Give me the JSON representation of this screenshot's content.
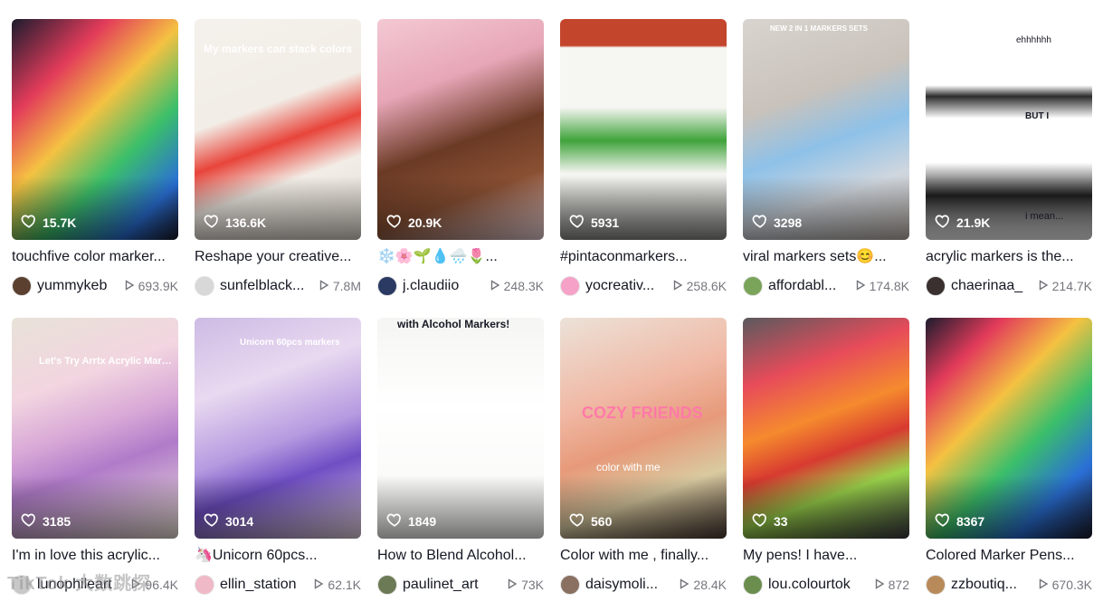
{
  "videos": [
    {
      "likes": "15.7K",
      "title": "touchfive color marker...",
      "user": "yummykeb",
      "views": "693.9K",
      "thumb": "linear-gradient(135deg,#1c1c2e 0%,#e23b5a 25%,#f5c142 45%,#3bbf6a 65%,#2a6fd6 85%,#1a1a2a 100%)",
      "avatar": "#5b4030"
    },
    {
      "likes": "136.6K",
      "title": "Reshape your creative...",
      "user": "sunfelblack...",
      "views": "7.8M",
      "thumb": "linear-gradient(160deg,#f4f1ec 0%,#f2ede6 40%,#e8443a 55%,#f2ede6 70%,#dfd8cf 100%)",
      "avatar": "#d8d8d8"
    },
    {
      "likes": "20.9K",
      "title": "❄️🌸🌱💧🌧️🌷...",
      "user": "j.claudiio",
      "views": "248.3K",
      "thumb": "linear-gradient(160deg,#f3c9d3 0%,#e7a6b7 30%,#6b3a25 55%,#8a5033 75%,#f0d7dd 100%)",
      "avatar": "#2b3a63"
    },
    {
      "likes": "5931",
      "title": "#pintaconmarkers...",
      "user": "yocreativ...",
      "views": "258.6K",
      "thumb": "linear-gradient(180deg,#c3452c 0%,#c3452c 12%,#f6f6f2 13%,#f6f6f2 40%,#3fa33a 55%,#f6f6f2 70%,#8e8e8a 100%)",
      "avatar": "#f6a1c8"
    },
    {
      "likes": "3298",
      "title": "viral markers sets😊...",
      "user": "affordabl...",
      "views": "174.8K",
      "thumb": "linear-gradient(160deg,#d9d4cf 0%,#c9c2bb 35%,#8ec1e8 55%,#cfd6de 75%,#bfb6ae 100%)",
      "avatar": "#7aa45a"
    },
    {
      "likes": "21.9K",
      "title": "acrylic markers is the...",
      "user": "chaerinaa_",
      "views": "214.7K",
      "thumb": "linear-gradient(180deg,#ffffff 0%,#ffffff 30%,#2c2c2c 35%,#ffffff 45%,#ffffff 65%,#1e1e1e 80%,#ffffff 100%)",
      "avatar": "#3a3030"
    },
    {
      "likes": "3185",
      "title": "I'm in love this acrylic...",
      "user": "lunophileart",
      "views": "96.4K",
      "thumb": "linear-gradient(160deg,#e8e2d8 0%,#f2d5e0 30%,#d7a6d6 50%,#b07bc9 65%,#f1e7dc 100%)",
      "avatar": "#c8c8c8"
    },
    {
      "likes": "3014",
      "title": "🦄Unicorn 60pcs...",
      "user": "ellin_station",
      "views": "62.1K",
      "thumb": "linear-gradient(160deg,#cdbbe4 0%,#e9d9f0 30%,#b59ae0 55%,#6f4ec4 70%,#e8d7e3 100%)",
      "avatar": "#f0b9c8"
    },
    {
      "likes": "1849",
      "title": "How to Blend Alcohol...",
      "user": "paulinet_art",
      "views": "73K",
      "thumb": "linear-gradient(180deg,#f5f5f3 0%,#ffffff 40%,#f7f7f5 100%)",
      "avatar": "#6c7a55"
    },
    {
      "likes": "560",
      "title": "Color with me , finally...",
      "user": "daisymoli...",
      "views": "28.4K",
      "thumb": "linear-gradient(160deg,#ece2d8 0%,#f0b8a4 35%,#e79a7a 55%,#d9caa0 75%,#4a3b33 100%)",
      "avatar": "#8a7060"
    },
    {
      "likes": "33",
      "title": "My pens! I have...",
      "user": "lou.colourtok",
      "views": "872",
      "thumb": "linear-gradient(160deg,#5a5a5e 0%,#e74b5a 25%,#f58a2e 45%,#d83a30 60%,#9ad24a 75%,#3a3a40 100%)",
      "avatar": "#6b8e4e"
    },
    {
      "likes": "8367",
      "title": "Colored Marker Pens...",
      "user": "zzboutiq...",
      "views": "670.3K",
      "thumb": "linear-gradient(135deg,#1c1c2e 0%,#e23b5a 20%,#f5c142 40%,#3bbf6a 60%,#2a6fd6 80%,#1a1a2a 100%)",
      "avatar": "#b88a5a"
    }
  ],
  "thumb_overlays": {
    "v2": "My markers can stack colors",
    "v12": "NEW 2 IN 1 MARKERS SETS",
    "v6_a": "ehhhhhh",
    "v6_b": "BUT I",
    "v6_c": "i mean...",
    "v7": "Let's Try Arrtx Acrylic Markers",
    "v8": "Unicorn 60pcs markers",
    "v9": "with Alcohol Markers!",
    "v10": "COZY FRIENDS",
    "v10_sub": "color with me"
  },
  "watermark": "TikTok 大数跳探"
}
